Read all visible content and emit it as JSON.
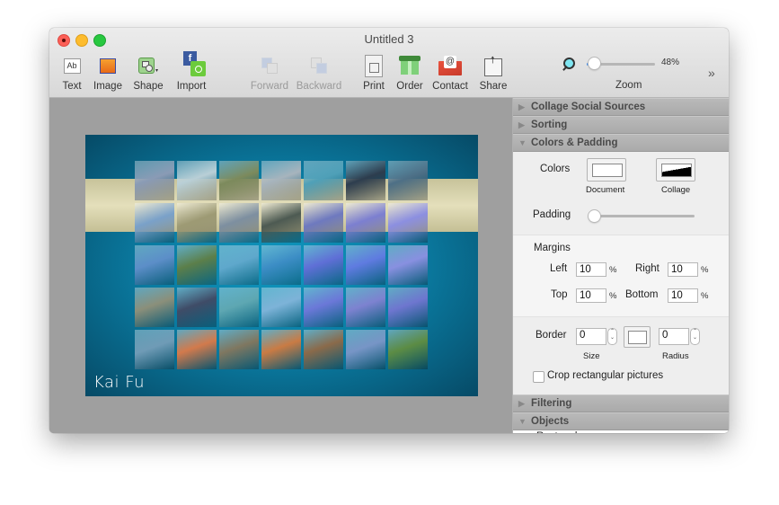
{
  "window": {
    "title": "Untitled 3"
  },
  "toolbar": {
    "items": [
      {
        "label": "Text",
        "icon": "text-icon",
        "enabled": true
      },
      {
        "label": "Image",
        "icon": "image-icon",
        "enabled": true
      },
      {
        "label": "Shape",
        "icon": "shape-icon",
        "enabled": true
      },
      {
        "label": "Import",
        "icon": "import-social-icon",
        "enabled": true
      },
      {
        "label": "Forward",
        "icon": "bring-forward-icon",
        "enabled": false
      },
      {
        "label": "Backward",
        "icon": "send-backward-icon",
        "enabled": false
      },
      {
        "label": "Print",
        "icon": "print-icon",
        "enabled": true
      },
      {
        "label": "Order",
        "icon": "order-box-icon",
        "enabled": true
      },
      {
        "label": "Contact",
        "icon": "contact-mail-icon",
        "enabled": true
      },
      {
        "label": "Share",
        "icon": "share-icon",
        "enabled": true
      }
    ],
    "zoom": {
      "label": "Zoom",
      "value_text": "48%",
      "value": 0.48,
      "slider_fraction": 0.1
    },
    "overflow_label": "»"
  },
  "canvas": {
    "signature": "Kai Fu",
    "colors": {
      "background": "#0a7aa0",
      "band": "#dcd7b0"
    },
    "grid": {
      "rows": 5,
      "columns": 7
    },
    "tiles": [
      "#8a9bb5",
      "#b9cfd6",
      "#7c8a5c",
      "#a7b4bd",
      "#4fa0b8",
      "#2d3d4e",
      "#4d6f86",
      "#7aa1c9",
      "#9d9a74",
      "#7d8fa0",
      "#4d5a52",
      "#6e79bf",
      "#7c7fd0",
      "#8c8fe0",
      "#5c8ec8",
      "#5c7f4a",
      "#5fa8cc",
      "#3c8dc5",
      "#5f6fd6",
      "#5f7be0",
      "#8890e0",
      "#8b8f7a",
      "#3f4c67",
      "#5ea7b2",
      "#7db3d8",
      "#6b78d8",
      "#7d82d0",
      "#6e76cf",
      "#6f9bb6",
      "#d27a4c",
      "#7f7760",
      "#c97b44",
      "#8a6a4a",
      "#7795c6",
      "#5c8c44"
    ]
  },
  "sidebar": {
    "sections": [
      {
        "title": "Collage Social Sources",
        "expanded": false
      },
      {
        "title": "Sorting",
        "expanded": false
      },
      {
        "title": "Colors & Padding",
        "expanded": true
      }
    ],
    "colors_padding": {
      "colors_label": "Colors",
      "document_label": "Document",
      "collage_label": "Collage",
      "document_color": "#ffffff",
      "padding_label": "Padding",
      "padding_fraction": 0.05,
      "margins_label": "Margins",
      "left_label": "Left",
      "left_value": "10",
      "right_label": "Right",
      "right_value": "10",
      "top_label": "Top",
      "top_value": "10",
      "bottom_label": "Bottom",
      "bottom_value": "10",
      "percent": "%",
      "border_label": "Border",
      "border_size": "0",
      "size_label": "Size",
      "border_radius": "0",
      "radius_label": "Radius",
      "crop_label": "Crop rectangular pictures",
      "crop_checked": false
    },
    "lower_sections": [
      {
        "title": "Filtering",
        "expanded": false
      },
      {
        "title": "Objects",
        "expanded": true
      }
    ],
    "objects": [
      {
        "label": "Rectangle"
      }
    ]
  }
}
